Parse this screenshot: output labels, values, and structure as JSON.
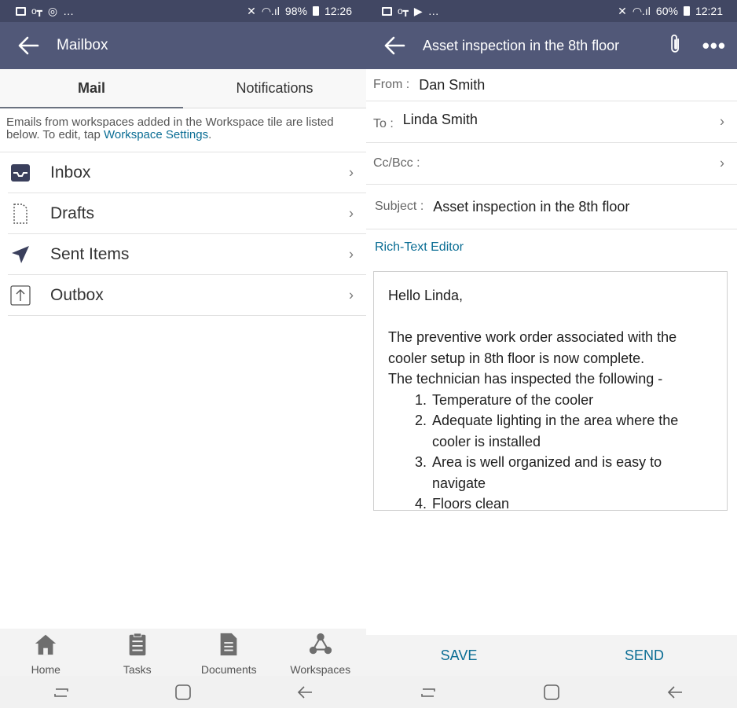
{
  "left": {
    "status": {
      "signal": "98%",
      "time": "12:26"
    },
    "appbar": {
      "title": "Mailbox"
    },
    "tabs": [
      {
        "label": "Mail"
      },
      {
        "label": "Notifications"
      }
    ],
    "info": {
      "text": "Emails from workspaces added in the Workspace tile are listed below. To edit, tap ",
      "link": "Workspace Settings",
      "end": "."
    },
    "folders": [
      {
        "label": "Inbox",
        "icon": "inbox-icon"
      },
      {
        "label": "Drafts",
        "icon": "draft-icon"
      },
      {
        "label": "Sent Items",
        "icon": "sent-icon"
      },
      {
        "label": "Outbox",
        "icon": "outbox-icon"
      }
    ],
    "bottom_nav": [
      {
        "label": "Home",
        "icon": "home-icon"
      },
      {
        "label": "Tasks",
        "icon": "tasks-icon"
      },
      {
        "label": "Documents",
        "icon": "documents-icon"
      },
      {
        "label": "Workspaces",
        "icon": "workspaces-icon"
      }
    ]
  },
  "right": {
    "status": {
      "signal": "60%",
      "time": "12:21"
    },
    "appbar": {
      "title": "Asset inspection in the 8th floor"
    },
    "from": {
      "label": "From :",
      "value": "Dan Smith"
    },
    "to": {
      "label": "To :",
      "value": "Linda Smith"
    },
    "ccbcc": {
      "label": "Cc/Bcc :"
    },
    "subject": {
      "label": "Subject :",
      "value": "Asset inspection in the 8th floor"
    },
    "rich_text_link": "Rich-Text Editor",
    "body": {
      "greeting": "Hello Linda,",
      "line1": "The preventive work order associated with the cooler setup in 8th floor is now complete.",
      "line2": "The technician has inspected the following -",
      "items": [
        "Temperature of the cooler",
        "Adequate lighting in the area where the cooler is installed",
        "Area is well organized and is easy to navigate",
        "Floors clean"
      ]
    },
    "actions": {
      "save": "SAVE",
      "send": "SEND"
    }
  },
  "colors": {
    "statusbar": "#414763",
    "appbar": "#515878",
    "link": "#0a6d94"
  }
}
